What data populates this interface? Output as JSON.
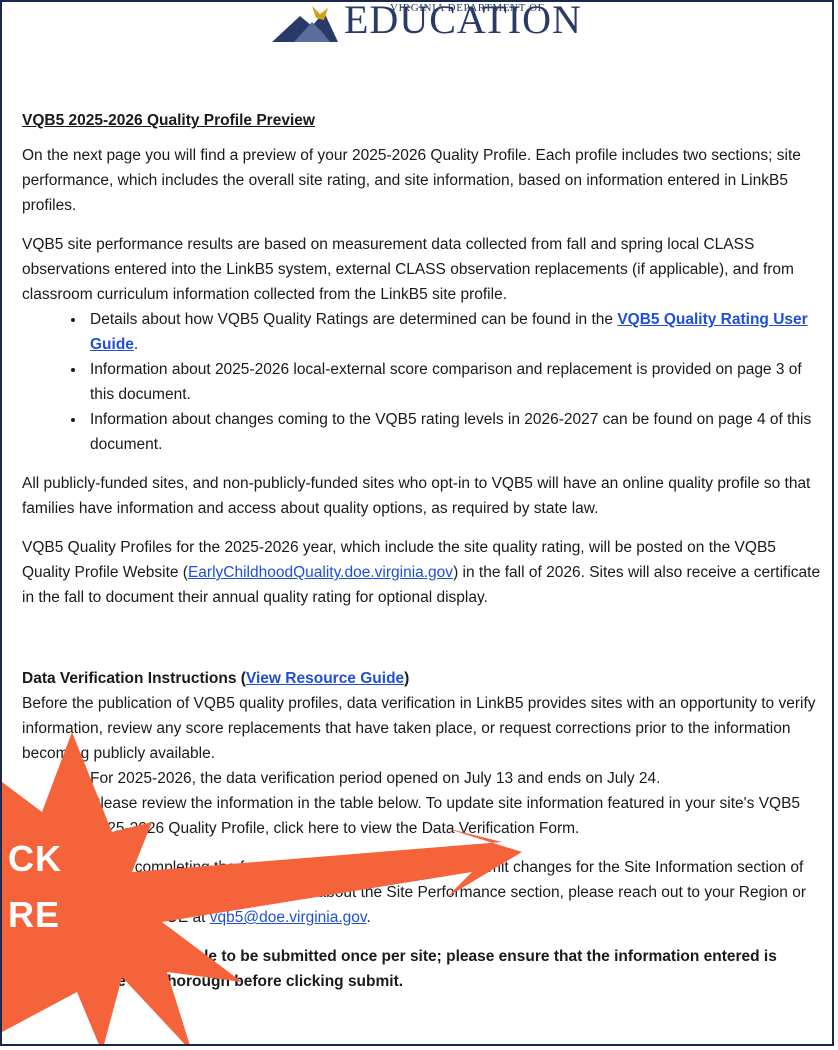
{
  "logo": {
    "small_text": "VIRGINIA DEPARTMENT OF",
    "big_text": "EDUCATION"
  },
  "section1": {
    "title": "VQB5 2025-2026 Quality Profile Preview",
    "para1": "On the next page you will find a preview of your 2025-2026 Quality Profile. Each profile includes two sections; site performance, which includes the overall site rating, and site information, based on information entered in LinkB5 profiles.",
    "para2": "VQB5 site performance results are based on measurement data collected from fall and spring local CLASS observations entered into the LinkB5 system, external CLASS observation replacements (if applicable), and from classroom curriculum information collected from the LinkB5 site profile.",
    "bullet1_pre": "Details about how VQB5 Quality Ratings are determined can be found in the ",
    "bullet1_link": "VQB5 Quality Rating User Guide",
    "bullet1_post": ".",
    "bullet2": "Information about 2025-2026 local-external score comparison and replacement is provided on page 3 of this document.",
    "bullet3": "Information about changes coming to the VQB5 rating levels in 2026-2027 can be found on page 4 of this document.",
    "para3": "All publicly-funded sites, and non-publicly-funded sites who opt-in to VQB5 will have an online quality profile so that families have information and access about quality options, as required by state law.",
    "para4_pre": "VQB5 Quality Profiles for the 2025-2026 year, which include the site quality rating, will be posted on the VQB5 Quality Profile Website (",
    "para4_link": "EarlyChildhoodQuality.doe.virginia.gov",
    "para4_post": ") in the fall of 2026. Sites will also receive a certificate in the fall to document their annual quality rating for optional display."
  },
  "section2": {
    "title_pre": "Data Verification Instructions (",
    "title_link": "View Resource Guide",
    "title_post": ")",
    "para1": "Before the publication of VQB5 quality profiles, data verification in LinkB5 provides sites with an opportunity to verify information, review any score replacements that have taken place, or request corrections prior to the information becoming publicly available.",
    "bullet1": "For 2025-2026, the data verification period opened on July 13 and ends on July 24.",
    "bullet2": "Please review the information in the table below. To update site information featured in your site's VQB5 2025-2026 Quality Profile, click here to view the Data Verification Form.",
    "para2_pre": "When completing the form, you will only be allowed to submit changes for the Site Information section of the profile. If you have questions about the Site Performance section, please reach out to your Region or contact VDOE at ",
    "para2_link": "vqb5@doe.virginia.gov",
    "para2_post": ".",
    "para3": "The form is only able to be submitted once per site; please ensure that the information entered is accurate and thorough before clicking submit."
  },
  "callout": {
    "line1": "CK",
    "line2": "RE",
    "color": "#f4633a"
  }
}
